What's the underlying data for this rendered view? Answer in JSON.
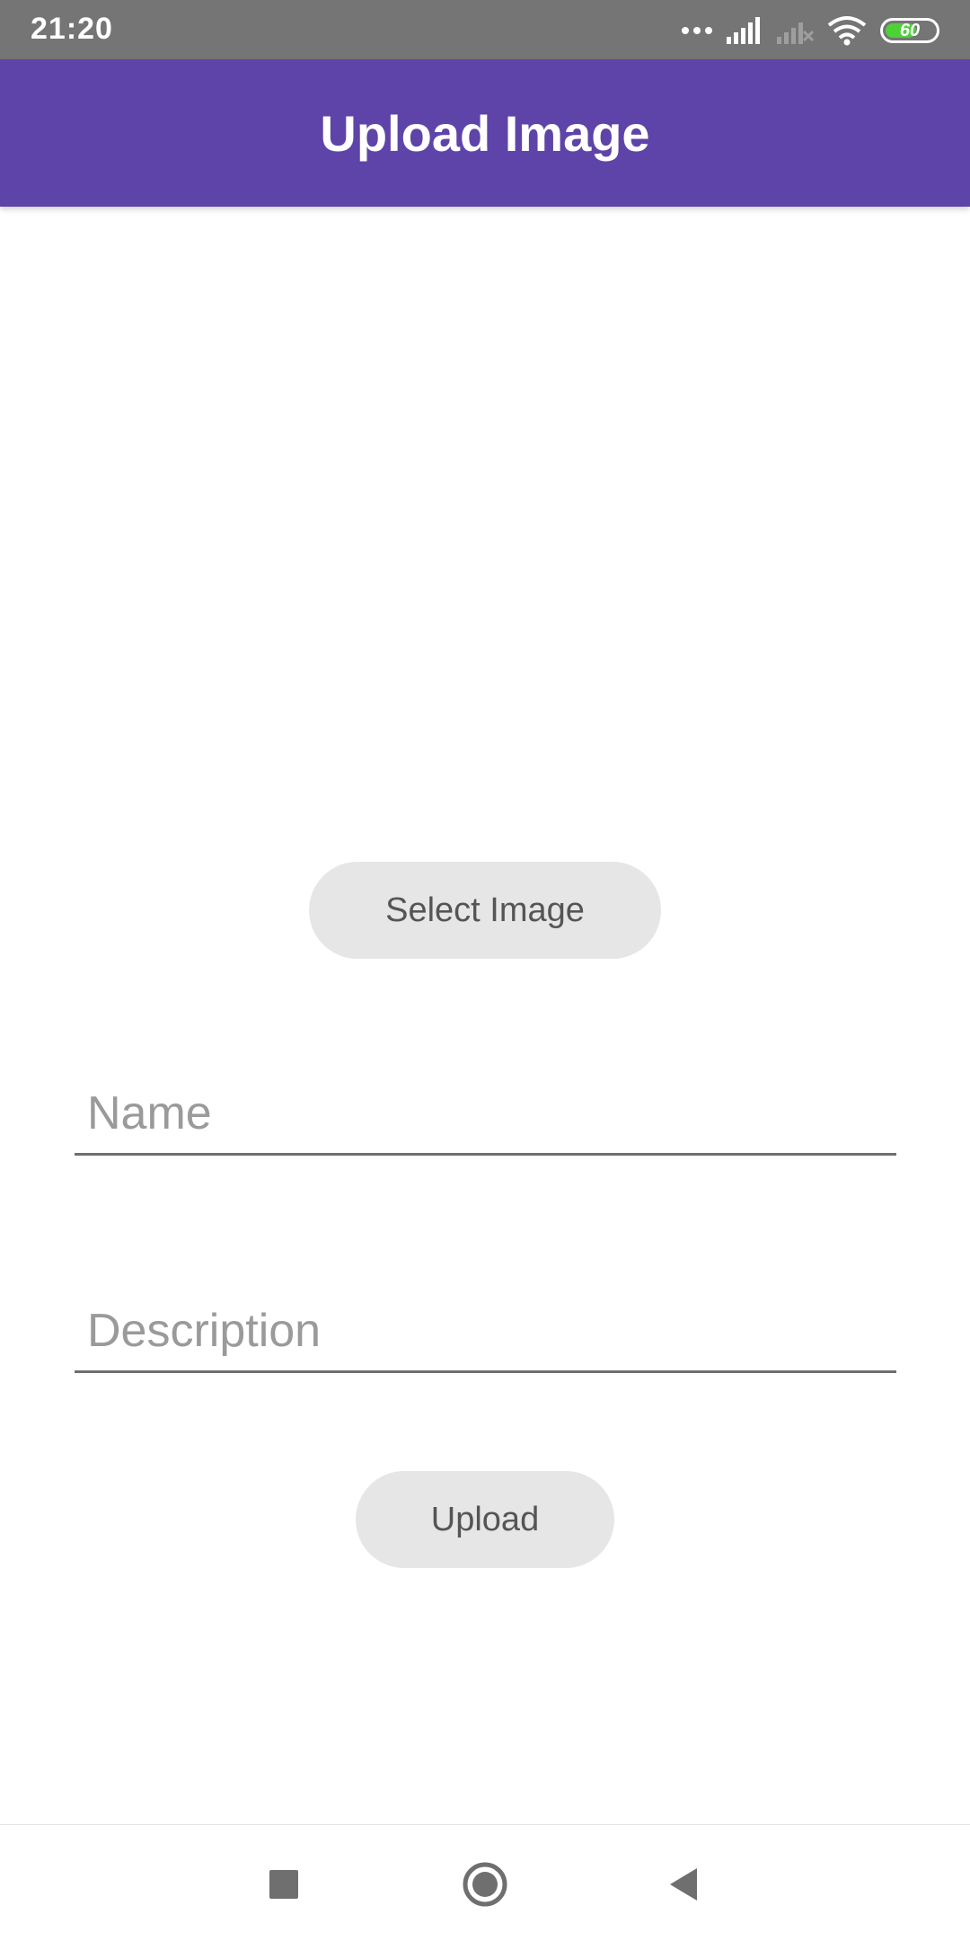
{
  "status_bar": {
    "time": "21:20",
    "battery_level": "60",
    "icons": [
      "more-dots-icon",
      "signal-icon",
      "signal-no-service-icon",
      "wifi-icon",
      "battery-icon"
    ]
  },
  "app_bar": {
    "title": "Upload Image",
    "color": "#5e44a8"
  },
  "form": {
    "select_image_label": "Select Image",
    "name_placeholder": "Name",
    "name_value": "",
    "description_placeholder": "Description",
    "description_value": "",
    "upload_label": "Upload"
  },
  "nav_bar": {
    "icons": [
      "recent-apps-icon",
      "home-icon",
      "back-icon"
    ]
  }
}
